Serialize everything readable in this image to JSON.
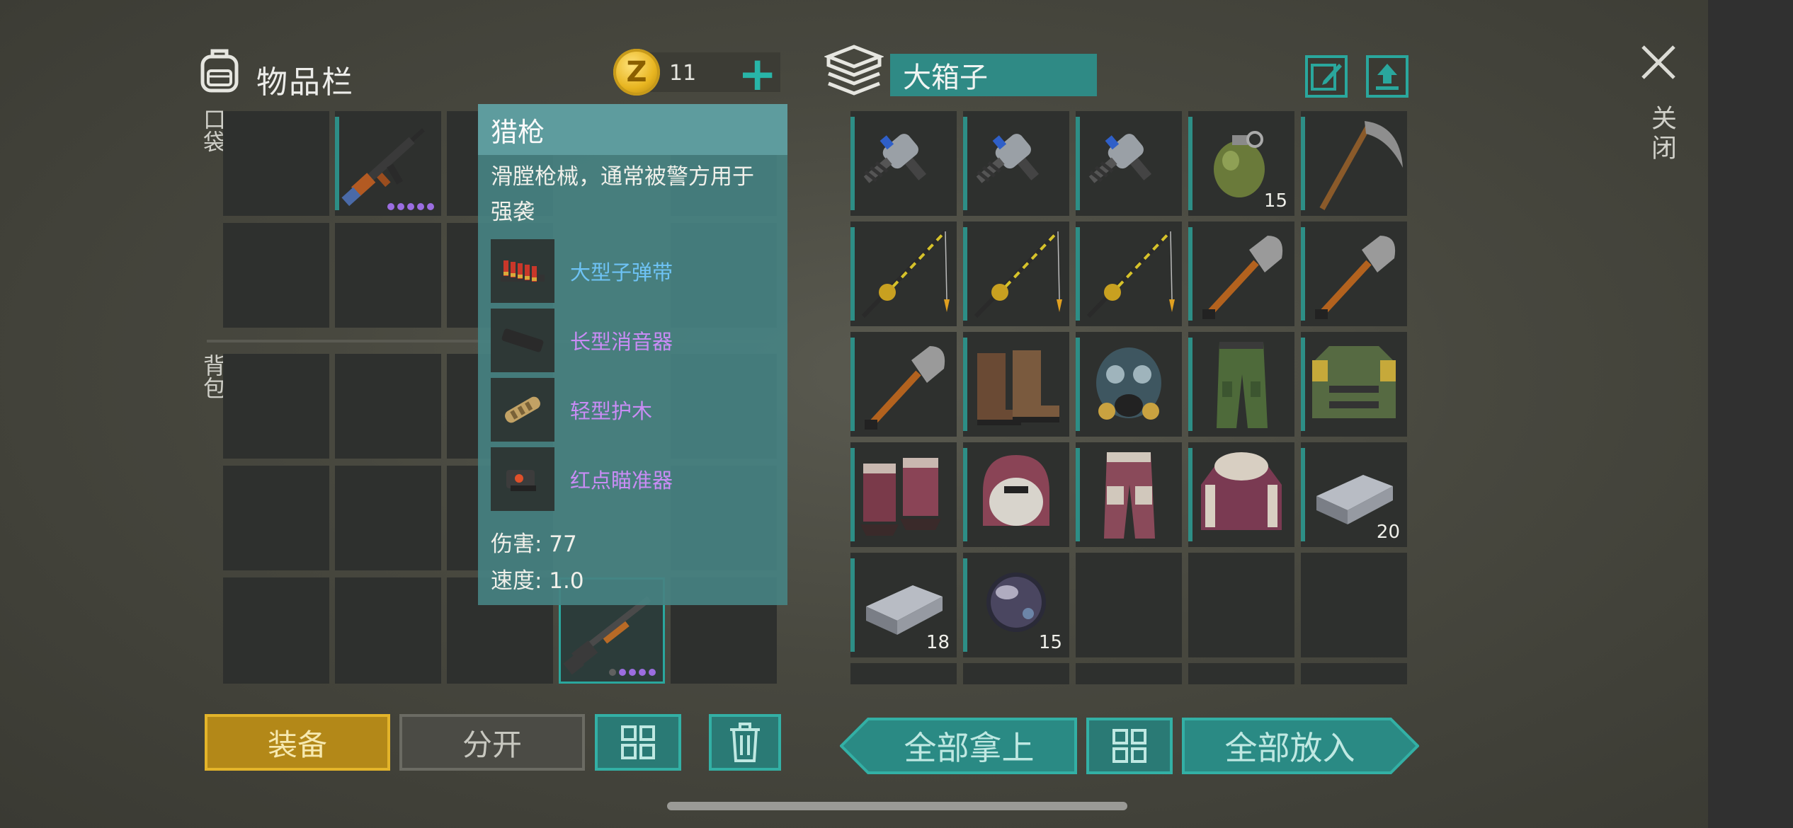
{
  "inventory": {
    "title": "物品栏",
    "pocket_label": "口袋",
    "backpack_label": "背包",
    "coins": "11"
  },
  "tooltip": {
    "title": "猎枪",
    "description": "滑膛枪械，通常被警方用于强袭",
    "mods": [
      {
        "name": "大型子弹带",
        "color": "#6ec3f5",
        "icon": "ammo-belt-icon"
      },
      {
        "name": "长型消音器",
        "color": "#c98cf5",
        "icon": "silencer-icon"
      },
      {
        "name": "轻型护木",
        "color": "#c98cf5",
        "icon": "handguard-icon"
      },
      {
        "name": "红点瞄准器",
        "color": "#c98cf5",
        "icon": "red-dot-sight-icon"
      }
    ],
    "damage": "伤害: 77",
    "speed": "速度: 1.0"
  },
  "box": {
    "title": "大箱子",
    "items": [
      {
        "icon": "drill-icon",
        "count": ""
      },
      {
        "icon": "drill-icon",
        "count": ""
      },
      {
        "icon": "drill-icon",
        "count": ""
      },
      {
        "icon": "grenade-icon",
        "count": "15"
      },
      {
        "icon": "scythe-icon",
        "count": ""
      },
      {
        "icon": "fishing-rod-icon",
        "count": ""
      },
      {
        "icon": "fishing-rod-icon",
        "count": ""
      },
      {
        "icon": "fishing-rod-icon",
        "count": ""
      },
      {
        "icon": "shovel-icon",
        "count": ""
      },
      {
        "icon": "shovel-icon",
        "count": ""
      },
      {
        "icon": "shovel-icon",
        "count": ""
      },
      {
        "icon": "boots-icon",
        "count": ""
      },
      {
        "icon": "gas-mask-icon",
        "count": ""
      },
      {
        "icon": "camo-pants-icon",
        "count": ""
      },
      {
        "icon": "armor-vest-icon",
        "count": ""
      },
      {
        "icon": "fur-boots-icon",
        "count": ""
      },
      {
        "icon": "fur-hat-icon",
        "count": ""
      },
      {
        "icon": "fur-pants-icon",
        "count": ""
      },
      {
        "icon": "fur-coat-icon",
        "count": ""
      },
      {
        "icon": "iron-ingot-icon",
        "count": "20"
      },
      {
        "icon": "iron-ingot-icon",
        "count": "18"
      },
      {
        "icon": "lens-icon",
        "count": "15"
      }
    ]
  },
  "close_label": "关闭",
  "buttons": {
    "equip": "装备",
    "split": "分开",
    "take_all": "全部拿上",
    "put_all": "全部放入"
  },
  "colors": {
    "teal": "#2aa79d",
    "gold": "#e3b42a",
    "rarity_purple": "#9b6de0"
  }
}
